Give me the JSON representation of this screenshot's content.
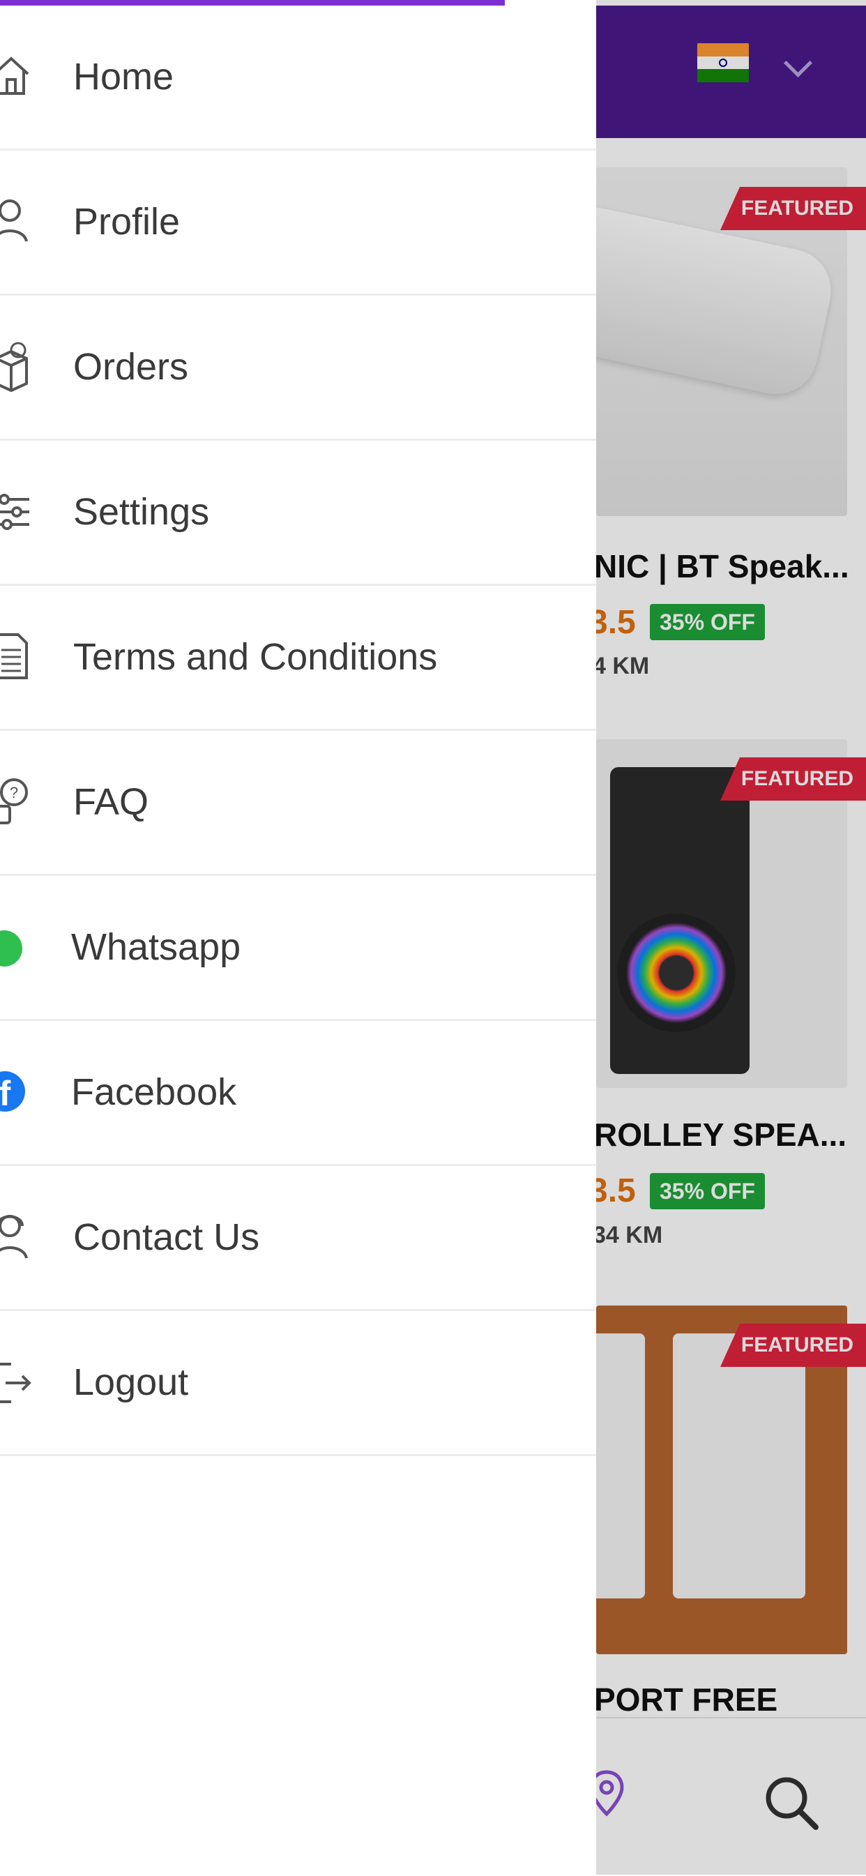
{
  "background_app": {
    "header_color": "#4a1a8c",
    "country_flag_icon": "india-flag-icon",
    "products": [
      {
        "badge": "FEATURED",
        "title": "NIC | BT Speak...",
        "price": "3.5",
        "discount": "35% OFF",
        "distance": "4 KM"
      },
      {
        "badge": "FEATURED",
        "title": "ROLLEY SPEA...",
        "price": "3.5",
        "discount": "35% OFF",
        "distance": "34 KM"
      },
      {
        "badge": "FEATURED",
        "title": "PORT FREE"
      }
    ],
    "bottom_nav": [
      "location-pin-icon",
      "search-icon"
    ]
  },
  "drawer": {
    "accent_color": "#7b2fd1",
    "items": [
      {
        "label": "Home",
        "icon": "home-icon"
      },
      {
        "label": "Profile",
        "icon": "user-icon"
      },
      {
        "label": "Orders",
        "icon": "box-icon"
      },
      {
        "label": "Settings",
        "icon": "sliders-icon"
      },
      {
        "label": "Terms and Conditions",
        "icon": "document-icon"
      },
      {
        "label": "FAQ",
        "icon": "question-bubble-icon"
      },
      {
        "label": "Whatsapp",
        "icon": "whatsapp-icon"
      },
      {
        "label": "Facebook",
        "icon": "facebook-icon"
      },
      {
        "label": "Contact Us",
        "icon": "support-agent-icon"
      },
      {
        "label": "Logout",
        "icon": "logout-icon"
      }
    ]
  }
}
